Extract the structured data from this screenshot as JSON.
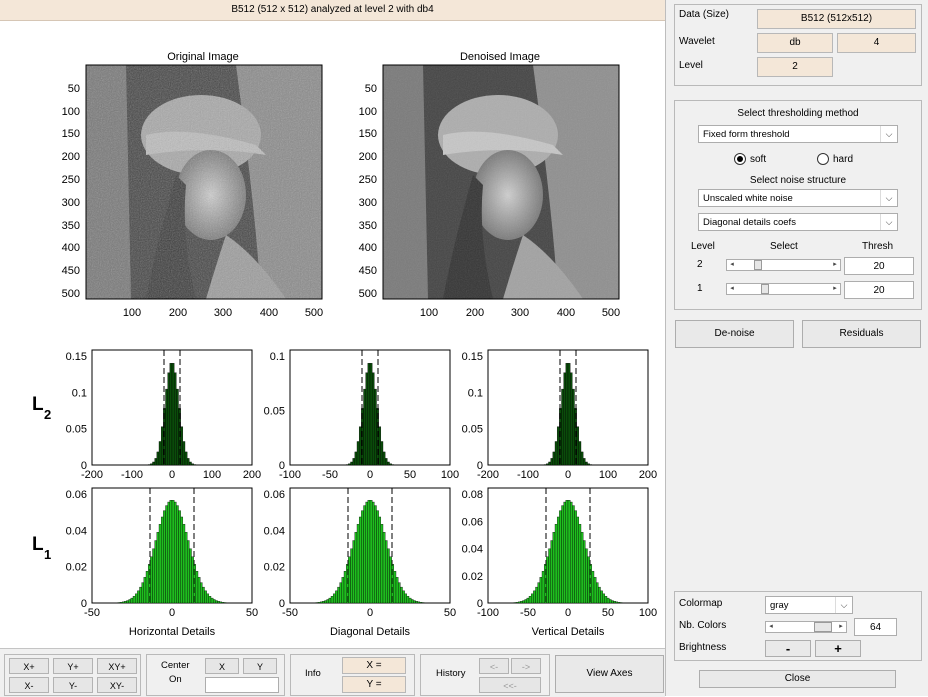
{
  "title": "B512  (512 x 512) analyzed at level 2 with db4",
  "images": {
    "original_title": "Original Image",
    "denoised_title": "Denoised Image",
    "y_ticks": [
      "50",
      "100",
      "150",
      "200",
      "250",
      "300",
      "350",
      "400",
      "450",
      "500"
    ],
    "x_ticks": [
      "100",
      "200",
      "300",
      "400",
      "500"
    ]
  },
  "histograms": {
    "row_labels": [
      {
        "main": "L",
        "sub": "2"
      },
      {
        "main": "L",
        "sub": "1"
      }
    ],
    "bottom_labels": [
      "Horizontal Details",
      "Diagonal Details",
      "Vertical Details"
    ],
    "L2": [
      {
        "y_ticks": [
          "0.15",
          "0.1",
          "0.05",
          "0"
        ],
        "x_ticks": [
          "-200",
          "-100",
          "0",
          "100",
          "200"
        ]
      },
      {
        "y_ticks": [
          "0.1",
          "0.05",
          "0"
        ],
        "x_ticks": [
          "-100",
          "-50",
          "0",
          "50",
          "100"
        ]
      },
      {
        "y_ticks": [
          "0.15",
          "0.1",
          "0.05",
          "0"
        ],
        "x_ticks": [
          "-200",
          "-100",
          "0",
          "100",
          "200"
        ]
      }
    ],
    "L1": [
      {
        "y_ticks": [
          "0.06",
          "0.04",
          "0.02",
          "0"
        ],
        "x_ticks": [
          "-50",
          "0",
          "50"
        ]
      },
      {
        "y_ticks": [
          "0.06",
          "0.04",
          "0.02",
          "0"
        ],
        "x_ticks": [
          "-50",
          "0",
          "50"
        ]
      },
      {
        "y_ticks": [
          "0.08",
          "0.06",
          "0.04",
          "0.02",
          "0"
        ],
        "x_ticks": [
          "-100",
          "-50",
          "0",
          "50",
          "100"
        ]
      }
    ]
  },
  "right": {
    "data_label": "Data  (Size)",
    "data_value": "B512  (512x512)",
    "wavelet_label": "Wavelet",
    "wavelet_family": "db",
    "wavelet_order": "4",
    "level_label": "Level",
    "level_value": "2",
    "thresh_method_title": "Select thresholding method",
    "thresh_method": "Fixed form threshold",
    "soft_label": "soft",
    "hard_label": "hard",
    "soft_selected": true,
    "noise_title": "Select noise structure",
    "noise_structure": "Unscaled white noise",
    "details_select": "Diagonal details coefs",
    "col_level": "Level",
    "col_select": "Select",
    "col_thresh": "Thresh",
    "rows": [
      {
        "level": "2",
        "thresh": "20",
        "slider_pos": 0.2
      },
      {
        "level": "1",
        "thresh": "20",
        "slider_pos": 0.28
      }
    ],
    "denoise_btn": "De-noise",
    "residuals_btn": "Residuals",
    "colormap_label": "Colormap",
    "colormap_value": "gray",
    "nbcolors_label": "Nb. Colors",
    "nbcolors_value": "64",
    "brightness_label": "Brightness",
    "minus_btn": "-",
    "plus_btn": "+",
    "close_btn": "Close"
  },
  "bottom": {
    "xplus": "X+",
    "yplus": "Y+",
    "xyplus": "XY+",
    "xminus": "X-",
    "yminus": "Y-",
    "xyminus": "XY-",
    "center_on_1": "Center",
    "center_on_2": "On",
    "x_btn": "X",
    "y_btn": "Y",
    "info_label": "Info",
    "x_eq": "X =",
    "y_eq": "Y =",
    "history_label": "History",
    "hist_back": "<-",
    "hist_fwd": "->",
    "hist_first": "<<-",
    "view_axes": "View Axes"
  },
  "colors": {
    "accent_bg": "#f4e7d8",
    "hist_dark": "#0a4d0a",
    "hist_light": "#1fbf1f"
  }
}
